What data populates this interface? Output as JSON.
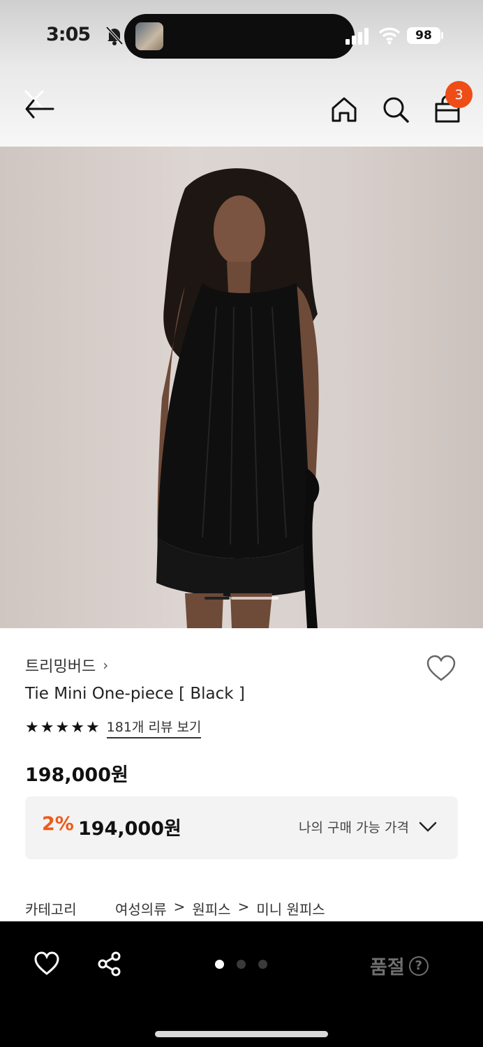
{
  "status_bar": {
    "time": "3:05",
    "battery": "98",
    "icons": [
      "bell-off-icon",
      "signal-icon",
      "wifi-icon",
      "battery-icon"
    ]
  },
  "app_bar": {
    "icons": [
      "back-arrow-icon",
      "close-icon",
      "home-icon",
      "search-icon",
      "shopping-bag-icon"
    ],
    "cart_count": "3"
  },
  "product": {
    "image_alt_icon": "product-photo",
    "image_page_indicator": {
      "active": 1,
      "total": 2
    },
    "brand": "트리밍버드",
    "brand_chevron": "›",
    "name": "Tie Mini One-piece [ Black ]",
    "rating_stars": 5,
    "star_glyph": "★",
    "review_link": "181개 리뷰 보기",
    "price": "198,000원",
    "member_price": {
      "discount_rate": "2%",
      "price": "194,000원",
      "label": "나의 구매 가능 가격"
    },
    "category": {
      "label": "카테고리",
      "path": [
        "여성의류",
        ">",
        "원피스",
        ">",
        "미니 원피스"
      ]
    }
  },
  "bottom_bar": {
    "pager": {
      "active": 0,
      "total": 3
    },
    "soldout_label": "품절",
    "help_glyph": "?"
  },
  "colors": {
    "accent_orange": "#ef5a1a",
    "badge_orange": "#ef4d17",
    "bottom_bar_bg": "#000000"
  }
}
